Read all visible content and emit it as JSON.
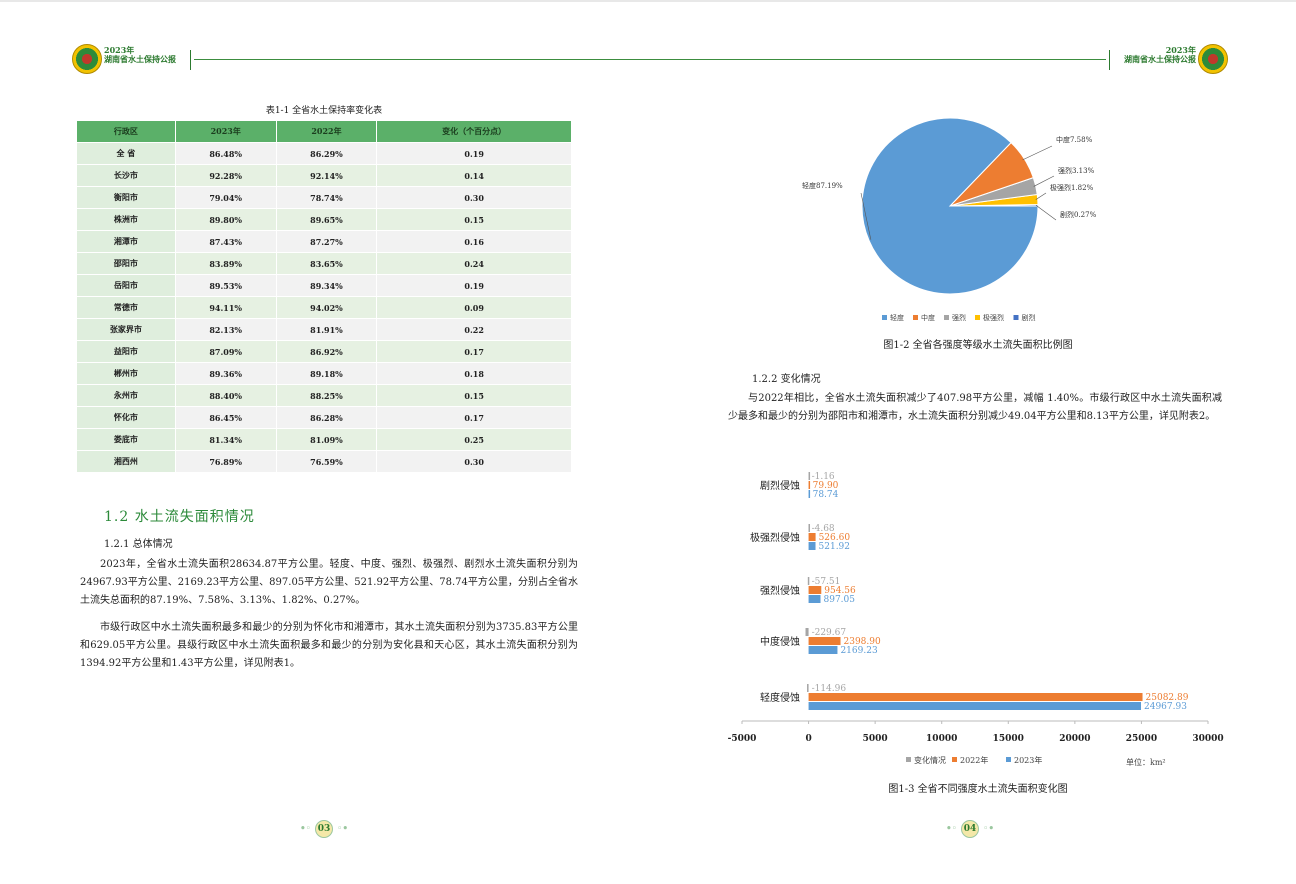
{
  "header": {
    "year_left": "2023年",
    "title_left": "湖南省水土保持公报",
    "year_right": "2023年",
    "title_right": "湖南省水土保持公报"
  },
  "table1": {
    "caption": "表1-1 全省水土保持率变化表",
    "headers": [
      "行政区",
      "2023年",
      "2022年",
      "变化（个百分点）"
    ],
    "rows": [
      [
        "全 省",
        "86.48%",
        "86.29%",
        "0.19"
      ],
      [
        "长沙市",
        "92.28%",
        "92.14%",
        "0.14"
      ],
      [
        "衡阳市",
        "79.04%",
        "78.74%",
        "0.30"
      ],
      [
        "株洲市",
        "89.80%",
        "89.65%",
        "0.15"
      ],
      [
        "湘潭市",
        "87.43%",
        "87.27%",
        "0.16"
      ],
      [
        "邵阳市",
        "83.89%",
        "83.65%",
        "0.24"
      ],
      [
        "岳阳市",
        "89.53%",
        "89.34%",
        "0.19"
      ],
      [
        "常德市",
        "94.11%",
        "94.02%",
        "0.09"
      ],
      [
        "张家界市",
        "82.13%",
        "81.91%",
        "0.22"
      ],
      [
        "益阳市",
        "87.09%",
        "86.92%",
        "0.17"
      ],
      [
        "郴州市",
        "89.36%",
        "89.18%",
        "0.18"
      ],
      [
        "永州市",
        "88.40%",
        "88.25%",
        "0.15"
      ],
      [
        "怀化市",
        "86.45%",
        "86.28%",
        "0.17"
      ],
      [
        "娄底市",
        "81.34%",
        "81.09%",
        "0.25"
      ],
      [
        "湘西州",
        "76.89%",
        "76.59%",
        "0.30"
      ]
    ]
  },
  "left": {
    "section_title": "1.2 水土流失面积情况",
    "sub_1": "1.2.1 总体情况",
    "para_1": "2023年，全省水土流失面积28634.87平方公里。轻度、中度、强烈、极强烈、剧烈水土流失面积分别为24967.93平方公里、2169.23平方公里、897.05平方公里、521.92平方公里、78.74平方公里，分别占全省水土流失总面积的87.19%、7.58%、3.13%、1.82%、0.27%。",
    "para_2": "市级行政区中水土流失面积最多和最少的分别为怀化市和湘潭市，其水土流失面积分别为3735.83平方公里和629.05平方公里。县级行政区中水土流失面积最多和最少的分别为安化县和天心区，其水土流失面积分别为1394.92平方公里和1.43平方公里，详见附表1。",
    "page_number": "03"
  },
  "right": {
    "fig2_caption": "图1-2 全省各强度等级水土流失面积比例图",
    "sub_2": "1.2.2 变化情况",
    "para_3": "与2022年相比，全省水土流失面积减少了407.98平方公里，减幅 1.40%。市级行政区中水土流失面积减少最多和最少的分别为邵阳市和湘潭市，水土流失面积分别减少49.04平方公里和8.13平方公里，详见附表2。",
    "fig3_caption": "图1-3 全省不同强度水土流失面积变化图",
    "unit_note": "单位：km²",
    "page_number": "04"
  },
  "chart_data": [
    {
      "type": "pie",
      "categories": [
        "轻度",
        "中度",
        "强烈",
        "极强烈",
        "剧烈"
      ],
      "values": [
        87.19,
        7.58,
        3.13,
        1.82,
        0.27
      ],
      "labels": [
        "轻度87.19%",
        "中度7.58%",
        "强烈3.13%",
        "极强烈1.82%",
        "剧烈0.27%"
      ],
      "colors": [
        "#5b9bd5",
        "#ed7d31",
        "#a5a5a5",
        "#ffc000",
        "#4472c4"
      ],
      "legend_position": "bottom"
    },
    {
      "type": "bar",
      "orientation": "horizontal",
      "categories": [
        "剧烈侵蚀",
        "极强烈侵蚀",
        "强烈侵蚀",
        "中度侵蚀",
        "轻度侵蚀"
      ],
      "series": [
        {
          "name": "变化情况",
          "values": [
            -1.16,
            -4.68,
            -57.51,
            -229.67,
            -114.96
          ],
          "labels": [
            "-1.16",
            "-4.68",
            "-57.51",
            "-229.67",
            "-114.96"
          ],
          "color": "#a5a5a5"
        },
        {
          "name": "2022年",
          "values": [
            79.9,
            526.6,
            954.56,
            2398.9,
            25082.89
          ],
          "labels": [
            "79.90",
            "526.60",
            "954.56",
            "2398.90",
            "25082.89"
          ],
          "color": "#ed7d31"
        },
        {
          "name": "2023年",
          "values": [
            78.74,
            521.92,
            897.05,
            2169.23,
            24967.93
          ],
          "labels": [
            "78.74",
            "521.92",
            "897.05",
            "2169.23",
            "24967.93"
          ],
          "color": "#5b9bd5"
        }
      ],
      "xlim": [
        -5000,
        30000
      ],
      "xticks": [
        "-5000",
        "0",
        "5000",
        "10000",
        "15000",
        "20000",
        "25000",
        "30000"
      ],
      "legend_position": "bottom"
    }
  ]
}
